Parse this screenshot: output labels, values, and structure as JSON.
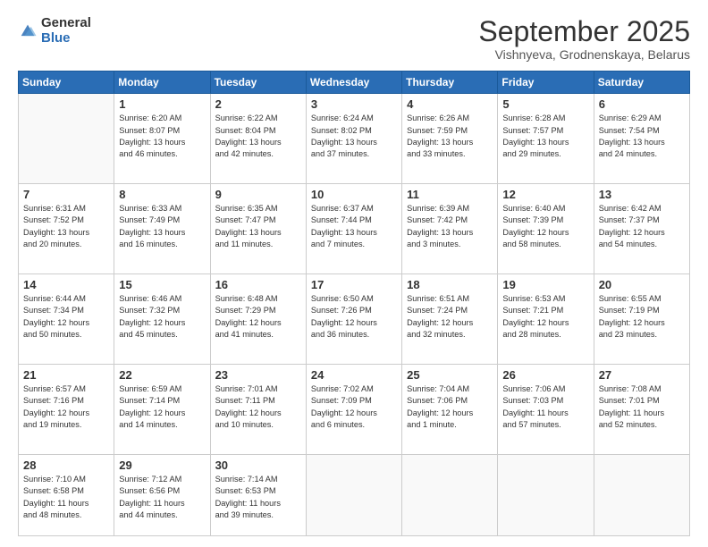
{
  "logo": {
    "general": "General",
    "blue": "Blue"
  },
  "header": {
    "month": "September 2025",
    "location": "Vishnyeva, Grodnenskaya, Belarus"
  },
  "days_of_week": [
    "Sunday",
    "Monday",
    "Tuesday",
    "Wednesday",
    "Thursday",
    "Friday",
    "Saturday"
  ],
  "weeks": [
    [
      {
        "day": "",
        "info": ""
      },
      {
        "day": "1",
        "info": "Sunrise: 6:20 AM\nSunset: 8:07 PM\nDaylight: 13 hours\nand 46 minutes."
      },
      {
        "day": "2",
        "info": "Sunrise: 6:22 AM\nSunset: 8:04 PM\nDaylight: 13 hours\nand 42 minutes."
      },
      {
        "day": "3",
        "info": "Sunrise: 6:24 AM\nSunset: 8:02 PM\nDaylight: 13 hours\nand 37 minutes."
      },
      {
        "day": "4",
        "info": "Sunrise: 6:26 AM\nSunset: 7:59 PM\nDaylight: 13 hours\nand 33 minutes."
      },
      {
        "day": "5",
        "info": "Sunrise: 6:28 AM\nSunset: 7:57 PM\nDaylight: 13 hours\nand 29 minutes."
      },
      {
        "day": "6",
        "info": "Sunrise: 6:29 AM\nSunset: 7:54 PM\nDaylight: 13 hours\nand 24 minutes."
      }
    ],
    [
      {
        "day": "7",
        "info": "Sunrise: 6:31 AM\nSunset: 7:52 PM\nDaylight: 13 hours\nand 20 minutes."
      },
      {
        "day": "8",
        "info": "Sunrise: 6:33 AM\nSunset: 7:49 PM\nDaylight: 13 hours\nand 16 minutes."
      },
      {
        "day": "9",
        "info": "Sunrise: 6:35 AM\nSunset: 7:47 PM\nDaylight: 13 hours\nand 11 minutes."
      },
      {
        "day": "10",
        "info": "Sunrise: 6:37 AM\nSunset: 7:44 PM\nDaylight: 13 hours\nand 7 minutes."
      },
      {
        "day": "11",
        "info": "Sunrise: 6:39 AM\nSunset: 7:42 PM\nDaylight: 13 hours\nand 3 minutes."
      },
      {
        "day": "12",
        "info": "Sunrise: 6:40 AM\nSunset: 7:39 PM\nDaylight: 12 hours\nand 58 minutes."
      },
      {
        "day": "13",
        "info": "Sunrise: 6:42 AM\nSunset: 7:37 PM\nDaylight: 12 hours\nand 54 minutes."
      }
    ],
    [
      {
        "day": "14",
        "info": "Sunrise: 6:44 AM\nSunset: 7:34 PM\nDaylight: 12 hours\nand 50 minutes."
      },
      {
        "day": "15",
        "info": "Sunrise: 6:46 AM\nSunset: 7:32 PM\nDaylight: 12 hours\nand 45 minutes."
      },
      {
        "day": "16",
        "info": "Sunrise: 6:48 AM\nSunset: 7:29 PM\nDaylight: 12 hours\nand 41 minutes."
      },
      {
        "day": "17",
        "info": "Sunrise: 6:50 AM\nSunset: 7:26 PM\nDaylight: 12 hours\nand 36 minutes."
      },
      {
        "day": "18",
        "info": "Sunrise: 6:51 AM\nSunset: 7:24 PM\nDaylight: 12 hours\nand 32 minutes."
      },
      {
        "day": "19",
        "info": "Sunrise: 6:53 AM\nSunset: 7:21 PM\nDaylight: 12 hours\nand 28 minutes."
      },
      {
        "day": "20",
        "info": "Sunrise: 6:55 AM\nSunset: 7:19 PM\nDaylight: 12 hours\nand 23 minutes."
      }
    ],
    [
      {
        "day": "21",
        "info": "Sunrise: 6:57 AM\nSunset: 7:16 PM\nDaylight: 12 hours\nand 19 minutes."
      },
      {
        "day": "22",
        "info": "Sunrise: 6:59 AM\nSunset: 7:14 PM\nDaylight: 12 hours\nand 14 minutes."
      },
      {
        "day": "23",
        "info": "Sunrise: 7:01 AM\nSunset: 7:11 PM\nDaylight: 12 hours\nand 10 minutes."
      },
      {
        "day": "24",
        "info": "Sunrise: 7:02 AM\nSunset: 7:09 PM\nDaylight: 12 hours\nand 6 minutes."
      },
      {
        "day": "25",
        "info": "Sunrise: 7:04 AM\nSunset: 7:06 PM\nDaylight: 12 hours\nand 1 minute."
      },
      {
        "day": "26",
        "info": "Sunrise: 7:06 AM\nSunset: 7:03 PM\nDaylight: 11 hours\nand 57 minutes."
      },
      {
        "day": "27",
        "info": "Sunrise: 7:08 AM\nSunset: 7:01 PM\nDaylight: 11 hours\nand 52 minutes."
      }
    ],
    [
      {
        "day": "28",
        "info": "Sunrise: 7:10 AM\nSunset: 6:58 PM\nDaylight: 11 hours\nand 48 minutes."
      },
      {
        "day": "29",
        "info": "Sunrise: 7:12 AM\nSunset: 6:56 PM\nDaylight: 11 hours\nand 44 minutes."
      },
      {
        "day": "30",
        "info": "Sunrise: 7:14 AM\nSunset: 6:53 PM\nDaylight: 11 hours\nand 39 minutes."
      },
      {
        "day": "",
        "info": ""
      },
      {
        "day": "",
        "info": ""
      },
      {
        "day": "",
        "info": ""
      },
      {
        "day": "",
        "info": ""
      }
    ]
  ]
}
